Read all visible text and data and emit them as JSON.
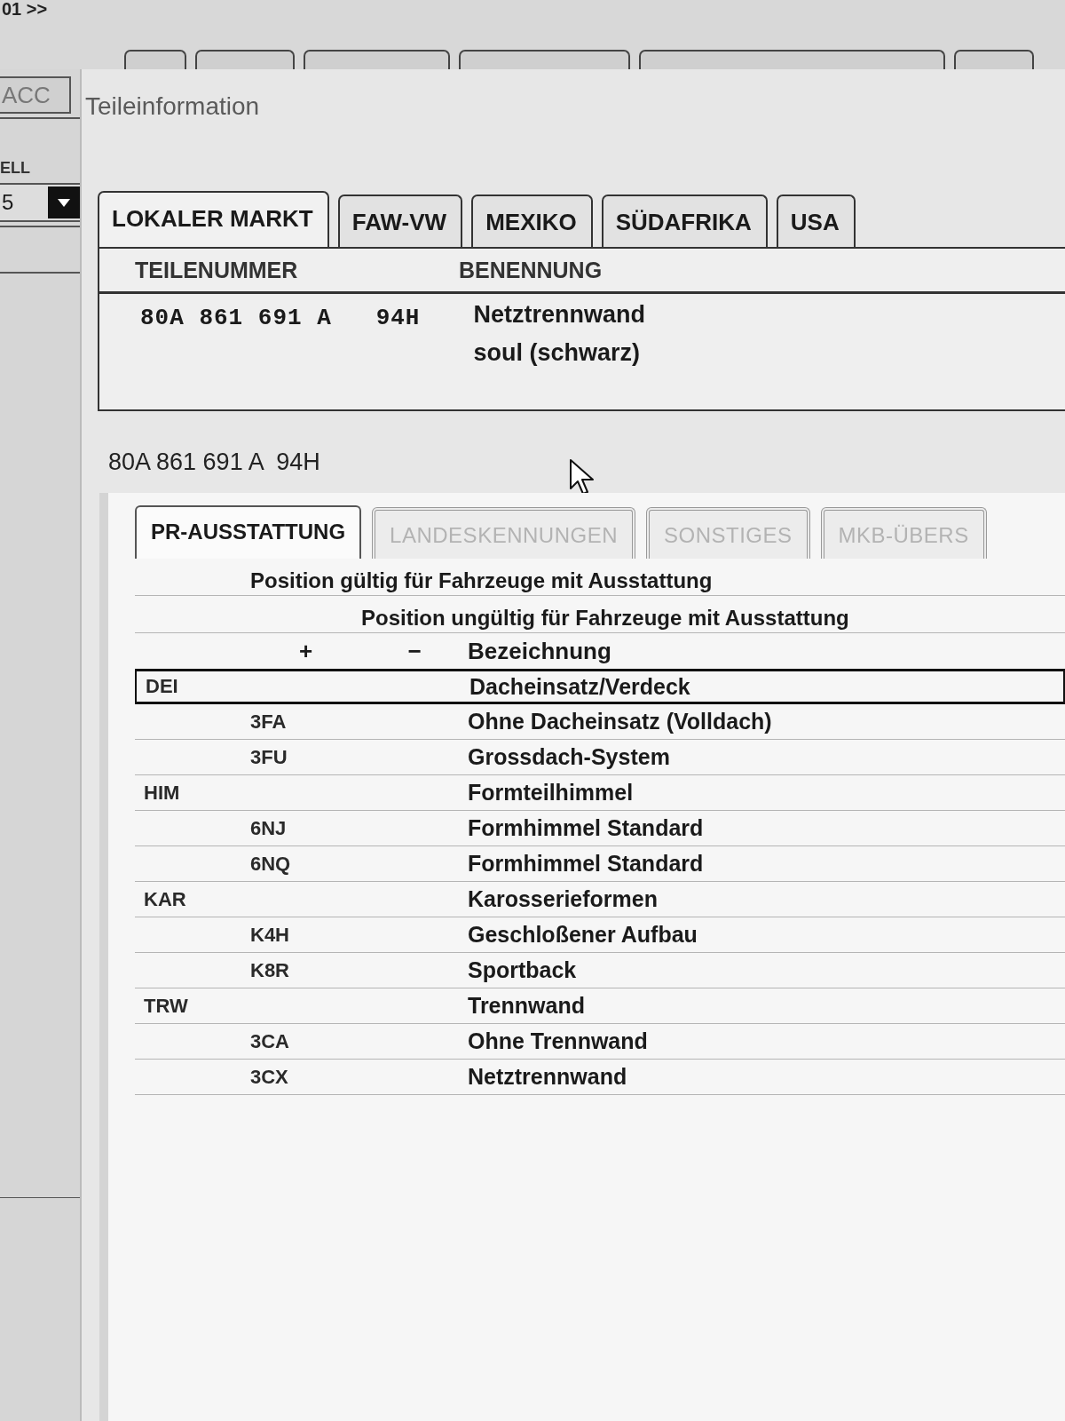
{
  "background_window": {
    "breadcrumb": "01 >>",
    "tab": "ACC",
    "field_label": "ELL",
    "dropdown": {
      "value": "5"
    }
  },
  "dialog": {
    "title": "Teileinformation"
  },
  "market_tabs": [
    {
      "label": "LOKALER MARKT",
      "selected": true
    },
    {
      "label": "FAW-VW",
      "selected": false
    },
    {
      "label": "MEXIKO",
      "selected": false
    },
    {
      "label": "SÜDAFRIKA",
      "selected": false
    },
    {
      "label": "USA",
      "selected": false
    }
  ],
  "parts_table": {
    "columns": [
      "TEILENUMMER",
      "BENENNUNG"
    ],
    "rows": [
      {
        "part_number": "80A 861 691 A   94H",
        "description": [
          "Netztrennwand",
          "soul (schwarz)"
        ]
      }
    ]
  },
  "part_number_label": "80A 861 691 A  94H",
  "detail_tabs": [
    {
      "label": "PR-AUSSTATTUNG",
      "selected": true,
      "disabled": false
    },
    {
      "label": "LANDESKENNUNGEN",
      "selected": false,
      "disabled": true
    },
    {
      "label": "SONSTIGES",
      "selected": false,
      "disabled": true
    },
    {
      "label": "MKB-ÜBERS",
      "selected": false,
      "disabled": true
    }
  ],
  "equipment": {
    "legend": [
      "Position gültig für Fahrzeuge mit Ausstattung",
      "Position ungültig für Fahrzeuge mit Ausstattung"
    ],
    "columns": [
      "+",
      "−",
      "Bezeichnung"
    ],
    "groups": [
      {
        "code": "DEI",
        "name": "Dacheinsatz/Verdeck",
        "selected": true,
        "children": [
          {
            "plus": "3FA",
            "name": "Ohne Dacheinsatz (Volldach)",
            "selected": false
          },
          {
            "plus": "3FU",
            "name": "Grossdach-System",
            "selected": false
          }
        ]
      },
      {
        "code": "HIM",
        "name": "Formteilhimmel",
        "selected": false,
        "children": [
          {
            "plus": "6NJ",
            "name": "Formhimmel Standard",
            "selected": false
          },
          {
            "plus": "6NQ",
            "name": "Formhimmel Standard",
            "selected": false
          }
        ]
      },
      {
        "code": "KAR",
        "name": "Karosserieformen",
        "selected": false,
        "children": [
          {
            "plus": "K4H",
            "name": "Geschloßener Aufbau",
            "selected": false
          },
          {
            "plus": "K8R",
            "name": "Sportback",
            "selected": false
          }
        ]
      },
      {
        "code": "TRW",
        "name": "Trennwand",
        "selected": false,
        "children": [
          {
            "plus": "3CA",
            "name": "Ohne Trennwand",
            "selected": false
          },
          {
            "plus": "3CX",
            "name": "Netztrennwand",
            "selected": false
          }
        ]
      }
    ]
  }
}
